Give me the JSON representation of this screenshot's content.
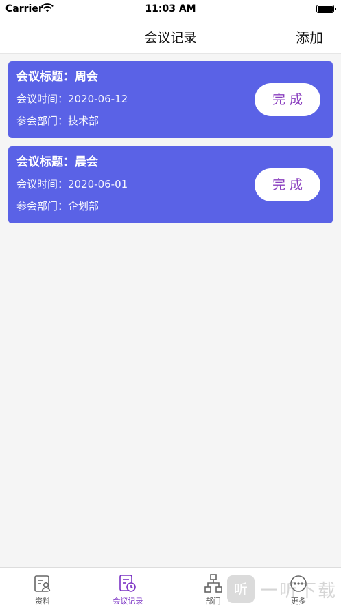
{
  "status_bar": {
    "carrier": "Carrier",
    "time": "11:03 AM"
  },
  "nav": {
    "title": "会议记录",
    "add_label": "添加"
  },
  "meetings": [
    {
      "title": "会议标题：周会",
      "time": "会议时间：2020-06-12",
      "dept": "参会部门：技术部",
      "action": "完成"
    },
    {
      "title": "会议标题：晨会",
      "time": "会议时间：2020-06-01",
      "dept": "参会部门：企划部",
      "action": "完成"
    }
  ],
  "tabs": [
    {
      "label": "资料",
      "icon": "profile-card-icon",
      "active": false
    },
    {
      "label": "会议记录",
      "icon": "meeting-clock-icon",
      "active": true
    },
    {
      "label": "部门",
      "icon": "org-chart-icon",
      "active": false
    },
    {
      "label": "更多",
      "icon": "more-dots-icon",
      "active": false
    }
  ],
  "watermark": {
    "logo_char": "听",
    "text": "一听下载"
  },
  "colors": {
    "card_bg": "#5a62e6",
    "accent": "#7b33c4",
    "button_text": "#8a3fbf"
  }
}
